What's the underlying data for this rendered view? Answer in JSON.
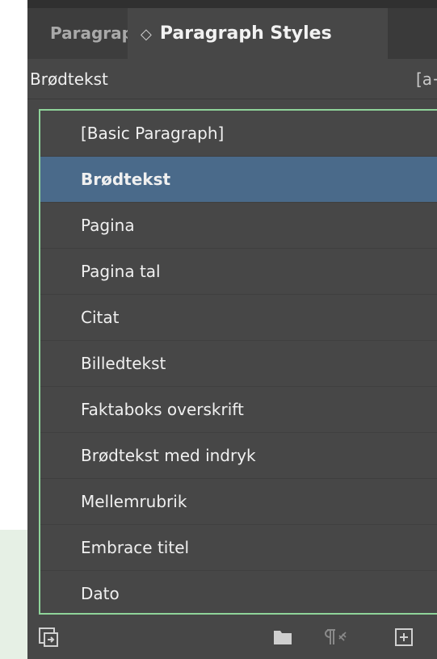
{
  "tabs": {
    "inactive_label": "Paragraph Styles",
    "active_chevron": "◇",
    "active_label": "Paragraph Styles"
  },
  "header": {
    "current_style": "Brødtekst",
    "shortcut_hint": "[a+]"
  },
  "styles": [
    {
      "label": "[Basic Paragraph]",
      "selected": false
    },
    {
      "label": "Brødtekst",
      "selected": true
    },
    {
      "label": "Pagina",
      "selected": false
    },
    {
      "label": "Pagina tal",
      "selected": false
    },
    {
      "label": "Citat",
      "selected": false
    },
    {
      "label": "Billedtekst",
      "selected": false
    },
    {
      "label": "Faktaboks overskrift",
      "selected": false
    },
    {
      "label": "Brødtekst med indryk",
      "selected": false
    },
    {
      "label": "Mellemrubrik",
      "selected": false
    },
    {
      "label": "Embrace titel",
      "selected": false
    },
    {
      "label": "Dato",
      "selected": false
    }
  ],
  "footer": {
    "icons": [
      "load-styles-icon",
      "folder-icon",
      "clear-overrides-icon",
      "new-style-icon"
    ]
  },
  "colors": {
    "panel": "#474747",
    "selection": "#4a6a8a",
    "focus_border": "#8fd49a"
  }
}
